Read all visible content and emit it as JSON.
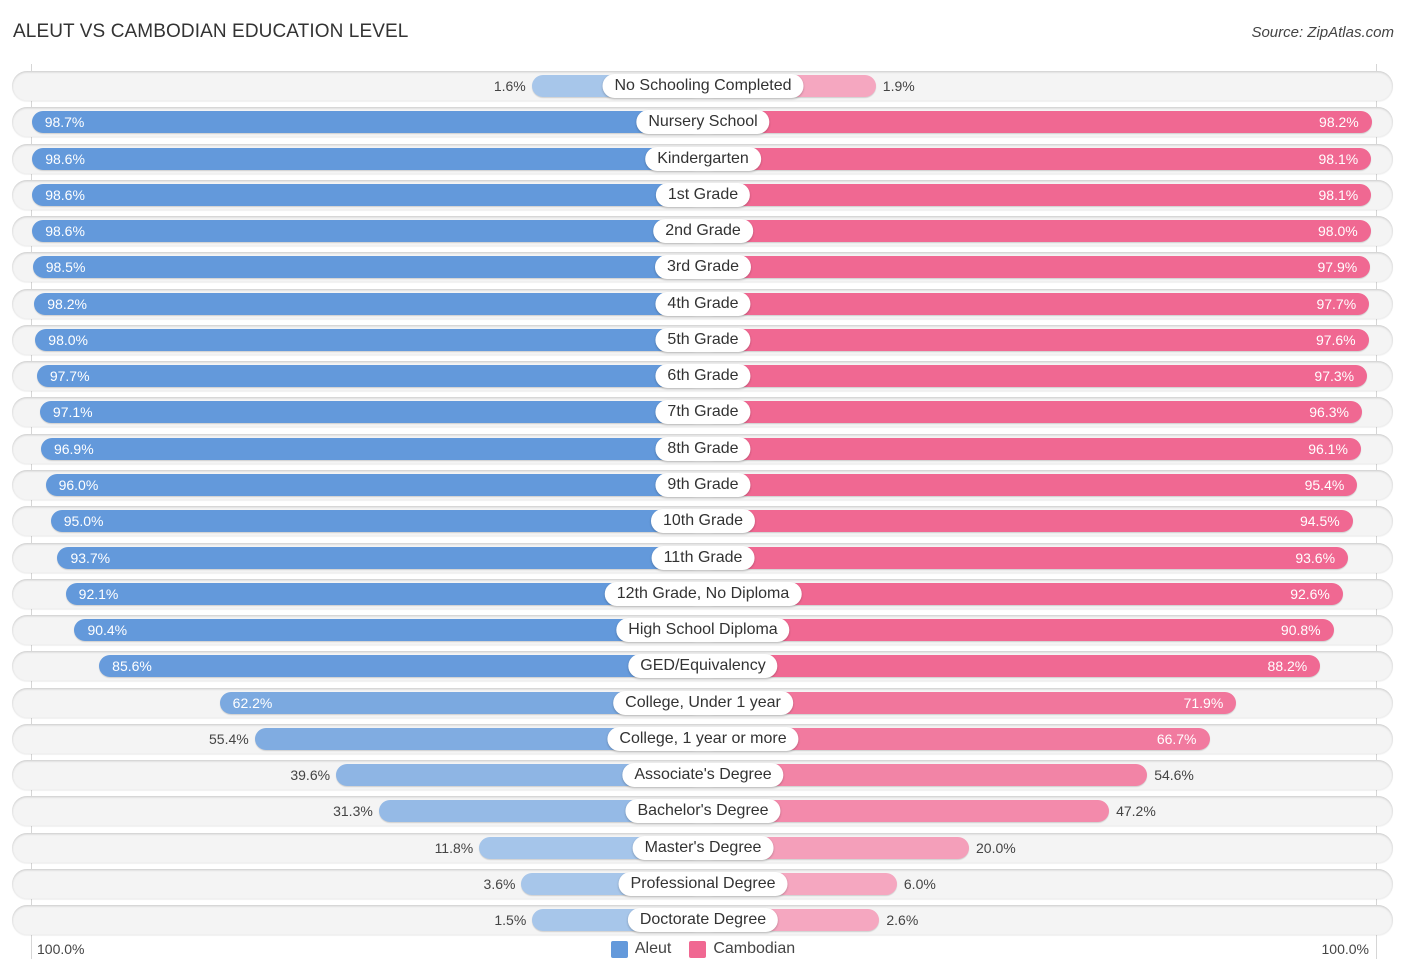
{
  "header": {
    "title": "ALEUT VS CAMBODIAN EDUCATION LEVEL",
    "source": "Source: ZipAtlas.com"
  },
  "axis": {
    "left_label": "100.0%",
    "right_label": "100.0%"
  },
  "legend": {
    "items": [
      {
        "label": "Aleut",
        "color": "#6399db"
      },
      {
        "label": "Cambodian",
        "color": "#f06892"
      }
    ]
  },
  "colors": {
    "aleut_strong": "#6399db",
    "aleut_light": "#a7c6ea",
    "cambodian_strong": "#f06892",
    "cambodian_light": "#f5a7c0"
  },
  "chart_data": {
    "type": "bar",
    "orientation": "horizontal-diverging",
    "title": "ALEUT VS CAMBODIAN EDUCATION LEVEL",
    "xlabel": "",
    "ylabel": "",
    "xlim": [
      0,
      100
    ],
    "unit": "%",
    "legend_position": "bottom-center",
    "categories": [
      "No Schooling Completed",
      "Nursery School",
      "Kindergarten",
      "1st Grade",
      "2nd Grade",
      "3rd Grade",
      "4th Grade",
      "5th Grade",
      "6th Grade",
      "7th Grade",
      "8th Grade",
      "9th Grade",
      "10th Grade",
      "11th Grade",
      "12th Grade, No Diploma",
      "High School Diploma",
      "GED/Equivalency",
      "College, Under 1 year",
      "College, 1 year or more",
      "Associate's Degree",
      "Bachelor's Degree",
      "Master's Degree",
      "Professional Degree",
      "Doctorate Degree"
    ],
    "series": [
      {
        "name": "Aleut",
        "side": "left",
        "values": [
          1.6,
          98.7,
          98.6,
          98.6,
          98.6,
          98.5,
          98.2,
          98.0,
          97.7,
          97.1,
          96.9,
          96.0,
          95.0,
          93.7,
          92.1,
          90.4,
          85.6,
          62.2,
          55.4,
          39.6,
          31.3,
          11.8,
          3.6,
          1.5
        ],
        "labels": [
          "1.6%",
          "98.7%",
          "98.6%",
          "98.6%",
          "98.6%",
          "98.5%",
          "98.2%",
          "98.0%",
          "97.7%",
          "97.1%",
          "96.9%",
          "96.0%",
          "95.0%",
          "93.7%",
          "92.1%",
          "90.4%",
          "85.6%",
          "62.2%",
          "55.4%",
          "39.6%",
          "31.3%",
          "11.8%",
          "3.6%",
          "1.5%"
        ]
      },
      {
        "name": "Cambodian",
        "side": "right",
        "values": [
          1.9,
          98.2,
          98.1,
          98.1,
          98.0,
          97.9,
          97.7,
          97.6,
          97.3,
          96.3,
          96.1,
          95.4,
          94.5,
          93.6,
          92.6,
          90.8,
          88.2,
          71.9,
          66.7,
          54.6,
          47.2,
          20.0,
          6.0,
          2.6
        ],
        "labels": [
          "1.9%",
          "98.2%",
          "98.1%",
          "98.1%",
          "98.0%",
          "97.9%",
          "97.7%",
          "97.6%",
          "97.3%",
          "96.3%",
          "96.1%",
          "95.4%",
          "94.5%",
          "93.6%",
          "92.6%",
          "90.8%",
          "88.2%",
          "71.9%",
          "66.7%",
          "54.6%",
          "47.2%",
          "20.0%",
          "6.0%",
          "2.6%"
        ]
      }
    ]
  }
}
